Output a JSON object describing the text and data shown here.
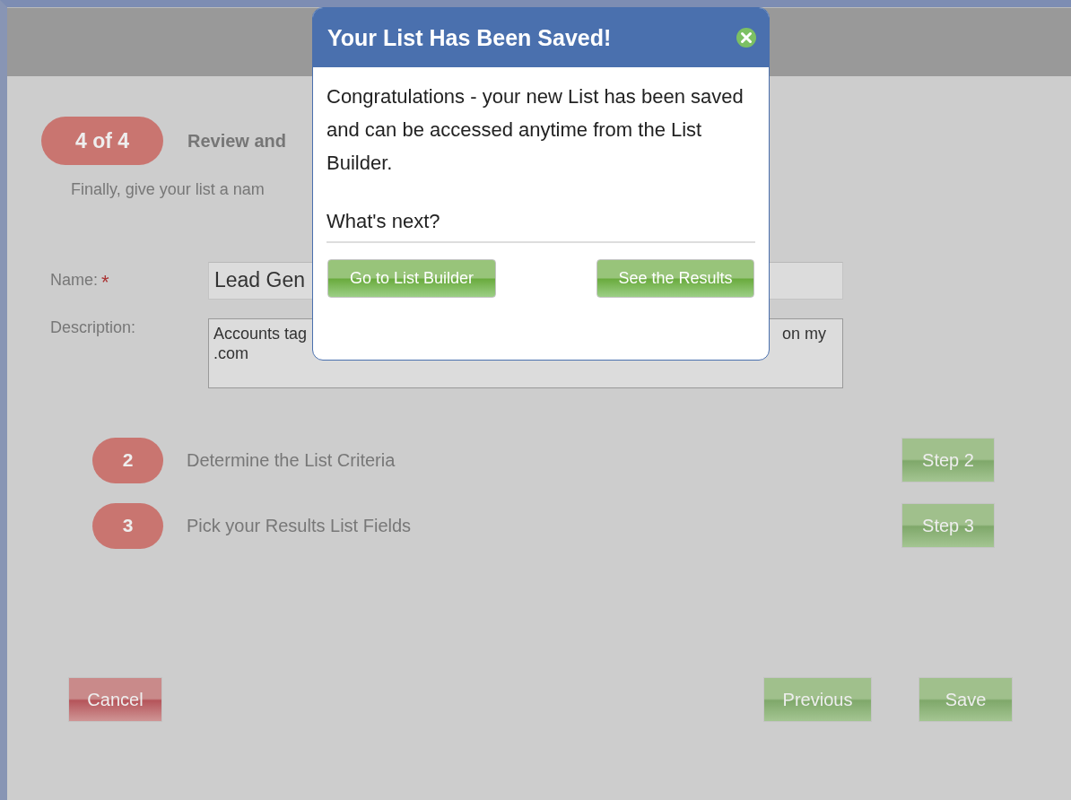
{
  "step_badge": "4 of 4",
  "step_title": "Review and",
  "instructions": "Finally, give your list a nam",
  "fields": [
    {
      "label": "Name:",
      "required_mark": "*",
      "lines": [
        {
          "left": "Lead Gen"
        }
      ]
    },
    {
      "label": "Description:",
      "lines": [
        {
          "left": "Accounts tag",
          "right": "on my"
        },
        {
          "left": ".com"
        }
      ]
    }
  ],
  "steps": [
    {
      "number": "2",
      "label": "Determine the List Criteria",
      "button": "Step 2"
    },
    {
      "number": "3",
      "label": "Pick your Results List Fields",
      "button": "Step 3"
    }
  ],
  "footer_buttons": [
    {
      "label": "Cancel",
      "kind": "danger"
    },
    {
      "label": "Previous",
      "kind": "primary"
    },
    {
      "label": "Save",
      "kind": "primary"
    }
  ],
  "dialog": {
    "title": "Your List Has Been Saved!",
    "paragraphs": [
      "Congratulations - your new List has been saved and can be accessed anytime from the List Builder.",
      "What's next?"
    ],
    "buttons": [
      "Go to List Builder",
      "See the Results"
    ]
  }
}
